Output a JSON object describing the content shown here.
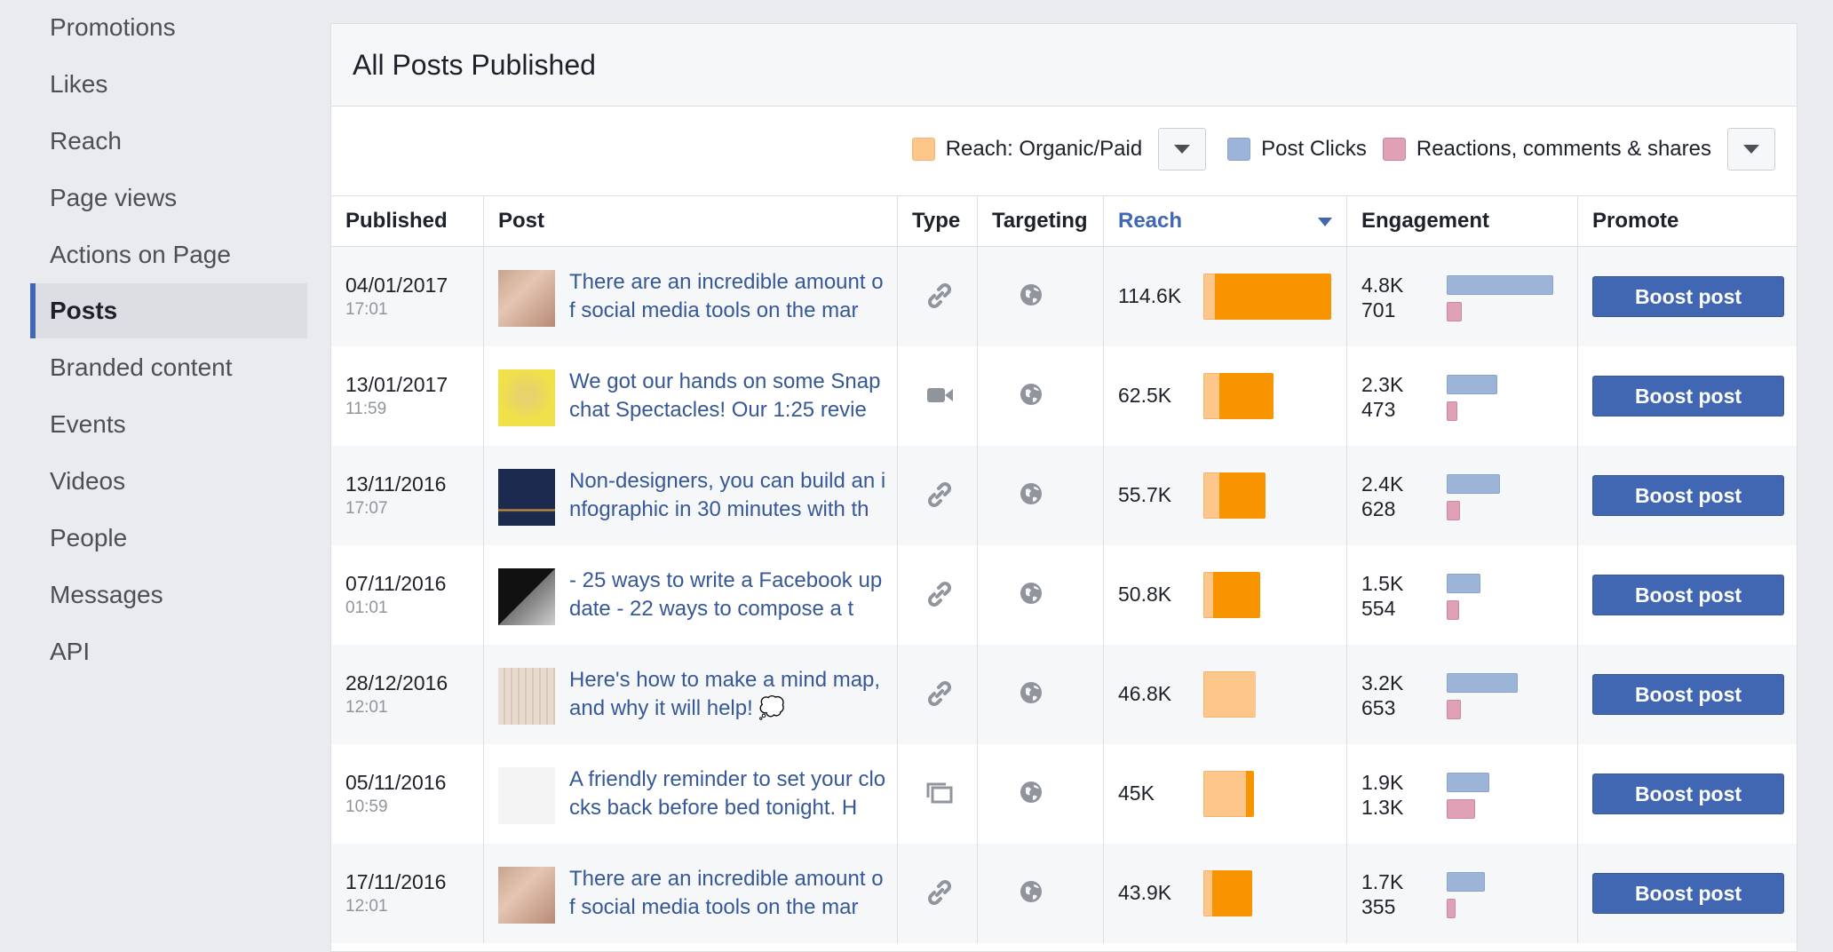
{
  "sidebar": {
    "items": [
      {
        "label": "Promotions"
      },
      {
        "label": "Likes"
      },
      {
        "label": "Reach"
      },
      {
        "label": "Page views"
      },
      {
        "label": "Actions on Page"
      },
      {
        "label": "Posts",
        "active": true
      },
      {
        "label": "Branded content"
      },
      {
        "label": "Events"
      },
      {
        "label": "Videos"
      },
      {
        "label": "People"
      },
      {
        "label": "Messages"
      },
      {
        "label": "API"
      }
    ]
  },
  "panel": {
    "title": "All Posts Published"
  },
  "legend": {
    "reach_label": "Reach: Organic/Paid",
    "clicks_label": "Post Clicks",
    "reactions_label": "Reactions, comments & shares",
    "colors": {
      "reach": "#fdc68a",
      "clicks": "#9cb4d8",
      "reactions": "#e0a0b6"
    }
  },
  "table": {
    "headers": {
      "published": "Published",
      "post": "Post",
      "type": "Type",
      "targeting": "Targeting",
      "reach": "Reach",
      "engagement": "Engagement",
      "promote": "Promote"
    },
    "boost_label": "Boost post",
    "rows": [
      {
        "date": "04/01/2017",
        "time": "17:01",
        "post": "There are an incredible amount of social media tools on the mar",
        "type_icon": "link-icon",
        "thumb_icon": "photo-thumbnail-icon",
        "reach": "114.6K",
        "reach_value": 114.6,
        "reach_organic_fraction": 0.09,
        "clicks": "4.8K",
        "clicks_value": 4.8,
        "reactions": "701",
        "reactions_value": 701
      },
      {
        "date": "13/01/2017",
        "time": "11:59",
        "post": "We got our hands on some Snapchat Spectacles! Our 1:25 revie",
        "type_icon": "video-icon",
        "thumb_icon": "photo-thumbnail-icon",
        "reach": "62.5K",
        "reach_value": 62.5,
        "reach_organic_fraction": 0.23,
        "clicks": "2.3K",
        "clicks_value": 2.3,
        "reactions": "473",
        "reactions_value": 473
      },
      {
        "date": "13/11/2016",
        "time": "17:07",
        "post": "Non-designers, you can build an infographic in 30 minutes with th",
        "type_icon": "link-icon",
        "thumb_icon": "photo-thumbnail-icon",
        "reach": "55.7K",
        "reach_value": 55.7,
        "reach_organic_fraction": 0.26,
        "clicks": "2.4K",
        "clicks_value": 2.4,
        "reactions": "628",
        "reactions_value": 628
      },
      {
        "date": "07/11/2016",
        "time": "01:01",
        "post": "- 25 ways to write a Facebook update - 22 ways to compose a t",
        "type_icon": "link-icon",
        "thumb_icon": "photo-thumbnail-icon",
        "reach": "50.8K",
        "reach_value": 50.8,
        "reach_organic_fraction": 0.17,
        "clicks": "1.5K",
        "clicks_value": 1.5,
        "reactions": "554",
        "reactions_value": 554
      },
      {
        "date": "28/12/2016",
        "time": "12:01",
        "post": "Here's how to make a mind map, and why it will help! 💭",
        "type_icon": "link-icon",
        "thumb_icon": "photo-thumbnail-icon",
        "reach": "46.8K",
        "reach_value": 46.8,
        "reach_organic_fraction": 1.0,
        "clicks": "3.2K",
        "clicks_value": 3.2,
        "reactions": "653",
        "reactions_value": 653
      },
      {
        "date": "05/11/2016",
        "time": "10:59",
        "post": "A friendly reminder to set your clocks back before bed tonight. H",
        "type_icon": "album-icon",
        "thumb_icon": "photo-thumbnail-icon",
        "reach": "45K",
        "reach_value": 45.0,
        "reach_organic_fraction": 0.85,
        "clicks": "1.9K",
        "clicks_value": 1.9,
        "reactions": "1.3K",
        "reactions_value": 1300
      },
      {
        "date": "17/11/2016",
        "time": "12:01",
        "post": "There are an incredible amount of social media tools on the mar",
        "type_icon": "link-icon",
        "thumb_icon": "photo-thumbnail-icon",
        "reach": "43.9K",
        "reach_value": 43.9,
        "reach_organic_fraction": 0.18,
        "clicks": "1.7K",
        "clicks_value": 1.7,
        "reactions": "355",
        "reactions_value": 355
      }
    ]
  }
}
